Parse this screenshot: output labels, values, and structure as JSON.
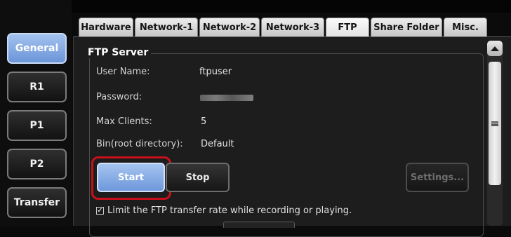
{
  "sidebar": {
    "items": [
      {
        "label": "General",
        "active": true
      },
      {
        "label": "R1",
        "active": false
      },
      {
        "label": "P1",
        "active": false
      },
      {
        "label": "P2",
        "active": false
      },
      {
        "label": "Transfer",
        "active": false
      }
    ]
  },
  "tabs": [
    {
      "label": "Hardware",
      "active": false
    },
    {
      "label": "Network-1",
      "active": false
    },
    {
      "label": "Network-2",
      "active": false
    },
    {
      "label": "Network-3",
      "active": false
    },
    {
      "label": "FTP",
      "active": true
    },
    {
      "label": "Share Folder",
      "active": false
    },
    {
      "label": "Misc.",
      "active": false
    }
  ],
  "ftp_server": {
    "title": "FTP Server",
    "fields": [
      {
        "label": "User Name:",
        "value": "ftpuser"
      },
      {
        "label": "Password:",
        "value": "",
        "masked": true
      },
      {
        "label": "Max Clients:",
        "value": "5"
      },
      {
        "label": "Bin(root directory):",
        "value": "Default"
      }
    ],
    "buttons": {
      "start": "Start",
      "stop": "Stop",
      "settings": "Settings..."
    },
    "limit_rate": {
      "checked": true,
      "label": "Limit the FTP transfer rate while recording or playing."
    }
  },
  "colors": {
    "accent": "#7ea4e2",
    "highlight": "#c8101b",
    "panel": "#1d1d1d"
  }
}
